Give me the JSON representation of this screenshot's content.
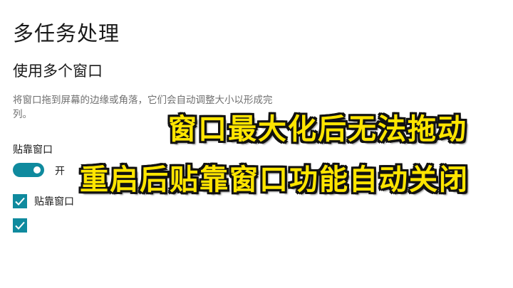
{
  "page": {
    "title": "多任务处理",
    "section_title": "使用多个窗口",
    "description_line1": "将窗口拖到屏幕的边缘或角落，它们会自动调整大小以形成完",
    "description_line2": "列。",
    "snap_label": "贴靠窗口",
    "snap_toggle_state": "开",
    "snap_toggle_on": true,
    "checkbox1_label": "贴靠窗口",
    "checkbox2_label": "",
    "accent_color": "#0f8a9e"
  },
  "overlay": {
    "line1": "窗口最大化后无法拖动",
    "line2": "重启后贴靠窗口功能自动关闭",
    "text_color": "#ffe500",
    "outline_color": "#111111"
  }
}
